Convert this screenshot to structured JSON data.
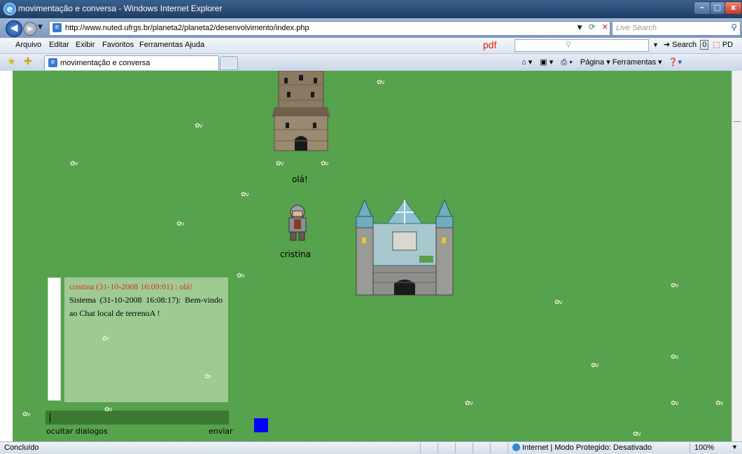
{
  "window": {
    "title": "movimentação e conversa - Windows Internet Explorer",
    "min": "–",
    "max": "□",
    "close": "x"
  },
  "address": {
    "url": "http://www.nuted.ufrgs.br/planeta2/planeta2/desenvolvimento/index.php",
    "search_placeholder": "Live Search"
  },
  "menu": {
    "items": [
      "Arquivo",
      "Editar",
      "Exibir",
      "Favoritos",
      "Ferramentas",
      "Ajuda"
    ],
    "pdf": "pdf",
    "search_btn": "Search",
    "count": "0",
    "pd": "PD"
  },
  "tabs": {
    "active": "movimentação e conversa",
    "commands": "Página ▾   Ferramentas ▾"
  },
  "game": {
    "speech": "olá!",
    "player_name": "cristina"
  },
  "chat": {
    "messages": [
      "cristina (31-10-2008 16:09:01) : olá!",
      "Sistema (31-10-2008 16:08:17): Bem-vindo ao Chat local de terrenoA !"
    ],
    "hide_label": "ocultar dialogos",
    "send_label": "enviar"
  },
  "status": {
    "text": "Concluído",
    "zone": "Internet | Modo Protegido: Desativado",
    "zoom": "100%"
  },
  "colors": {
    "terrain": "#57a24c",
    "chat_bg": "#9fcb93",
    "chat_highlight": "#d0312d",
    "marker": "#0000ff"
  }
}
